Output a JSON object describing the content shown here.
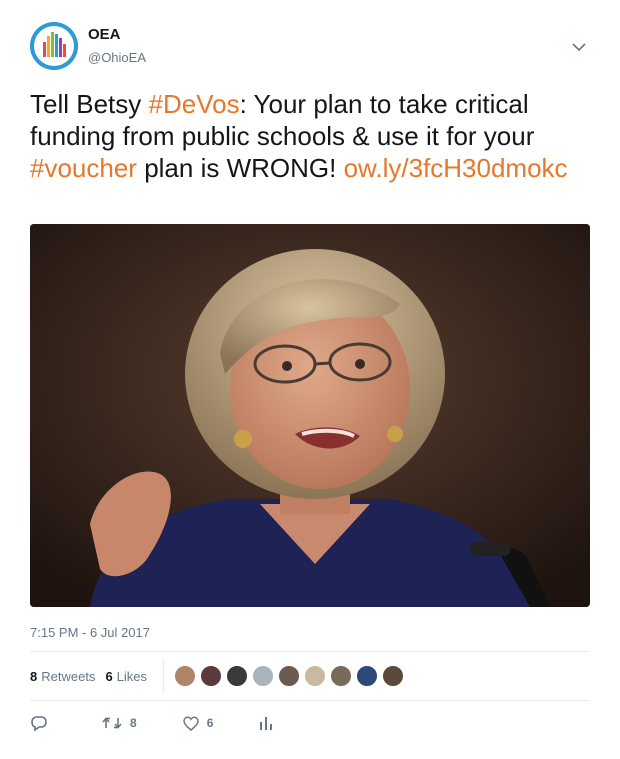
{
  "user": {
    "name": "OEA",
    "handle": "@OhioEA"
  },
  "tweet": {
    "part1": "Tell Betsy ",
    "hashtag1": "#DeVos",
    "part2": ": Your plan to take critical funding from public schools & use it for your ",
    "hashtag2": "#voucher",
    "part3": " plan is WRONG! ",
    "link": "ow.ly/3fcH30dmokc",
    "link_color": "#e5782b"
  },
  "timestamp": "7:15 PM - 6 Jul 2017",
  "stats": {
    "retweets_count": "8",
    "retweets_label": "Retweets",
    "likes_count": "6",
    "likes_label": "Likes",
    "liker_colors": [
      "#b08466",
      "#5a3a3a",
      "#3a3a3a",
      "#aab4bd",
      "#6b5a4e",
      "#c9b9a0",
      "#7a6a5a",
      "#2a4a7a",
      "#5a4a3a"
    ]
  },
  "actions": {
    "reply_count": "",
    "retweet_count": "8",
    "like_count": "6"
  }
}
